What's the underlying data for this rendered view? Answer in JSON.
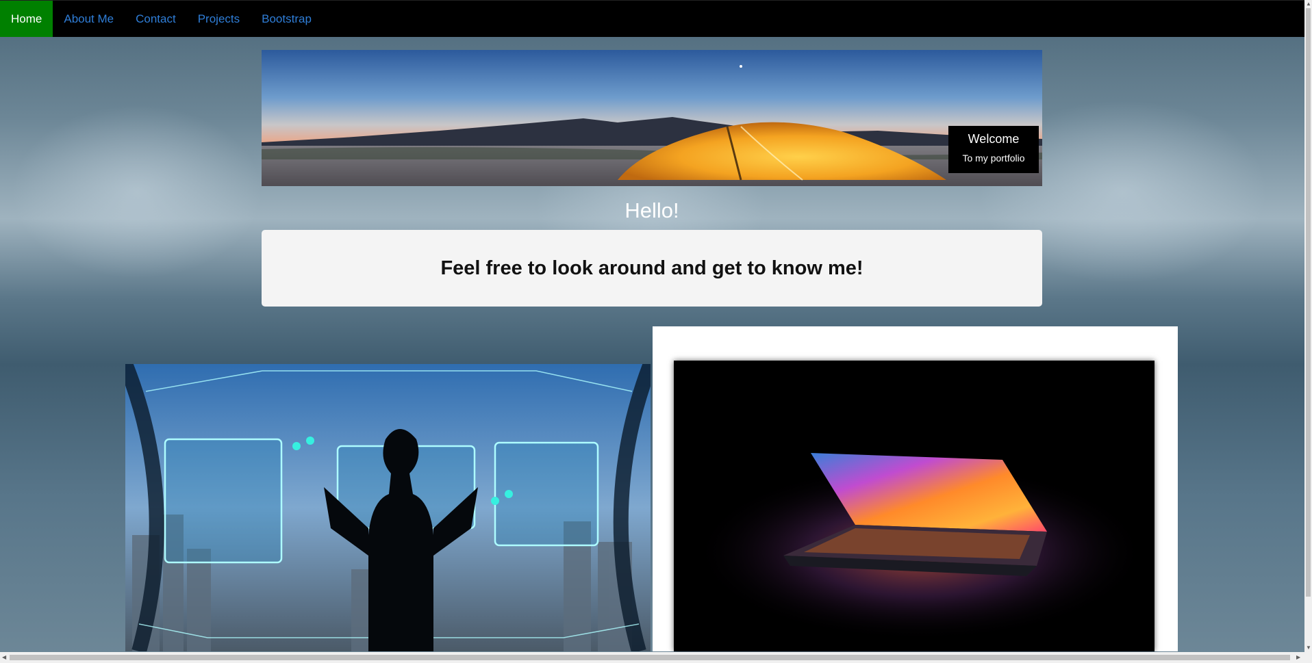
{
  "nav": {
    "items": [
      {
        "label": "Home",
        "active": true
      },
      {
        "label": "About Me",
        "active": false
      },
      {
        "label": "Contact",
        "active": false
      },
      {
        "label": "Projects",
        "active": false
      },
      {
        "label": "Bootstrap",
        "active": false
      }
    ]
  },
  "banner": {
    "welcome_title": "Welcome",
    "welcome_subtitle": "To my portfolio"
  },
  "greeting": "Hello!",
  "intro": {
    "text": "Feel free to look around and get to know me!"
  },
  "colors": {
    "nav_bg": "#000000",
    "nav_active_bg": "#008000",
    "nav_link": "#2f7ed8",
    "card_bg": "#f4f4f4"
  }
}
